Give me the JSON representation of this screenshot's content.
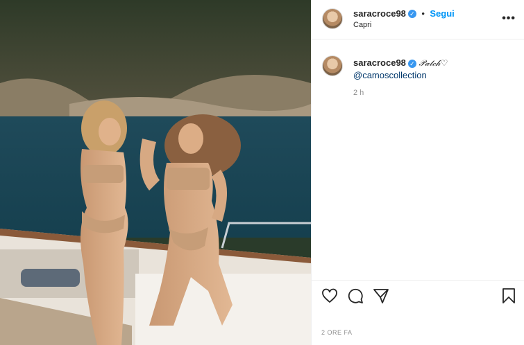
{
  "post": {
    "username": "saracroce98",
    "follow_label": "Segui",
    "location": "Capri",
    "more_label": "•••",
    "caption_text": "𝒫𝒶𝓉𝒸𝒽♡",
    "mention": "@camoscollection",
    "time_ago": "2 h",
    "footer_time": "2 ORE FA"
  },
  "icons": {
    "verified": "verified-badge-icon",
    "like": "heart-icon",
    "comment": "comment-icon",
    "share": "paper-plane-icon",
    "save": "bookmark-icon"
  },
  "colors": {
    "accent": "#0095f6",
    "verified": "#3897f0",
    "muted": "#8e8e8e"
  }
}
